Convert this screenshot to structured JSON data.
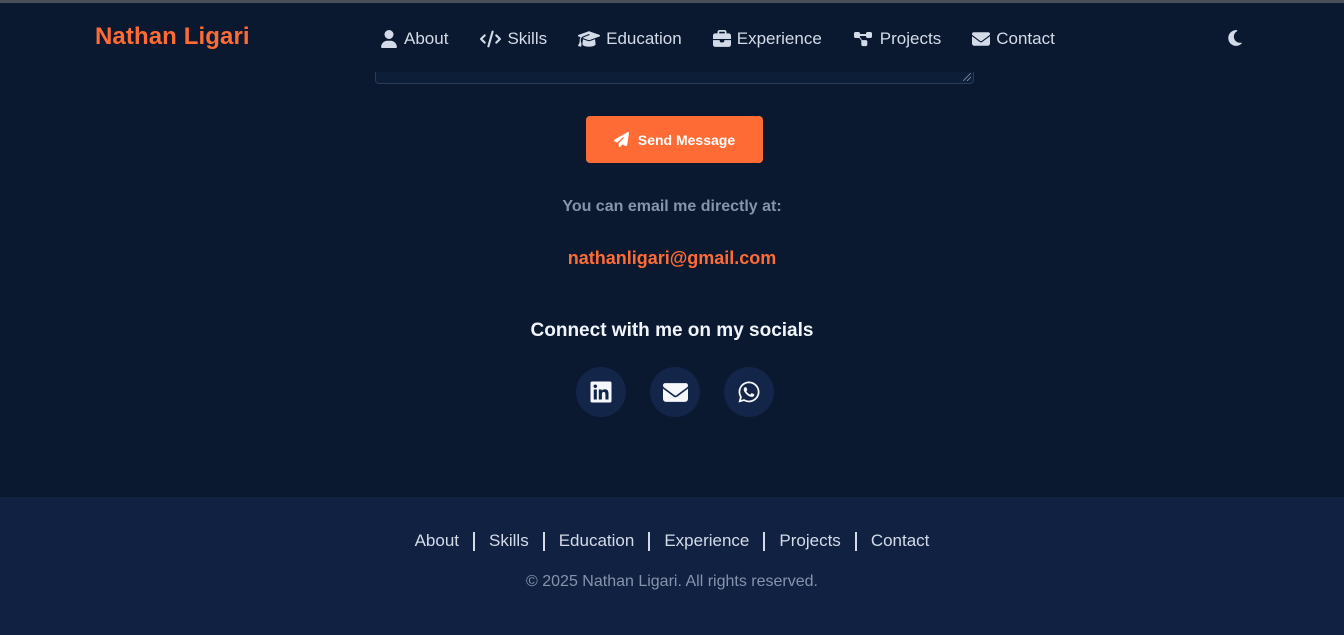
{
  "brand": "Nathan Ligari",
  "nav": {
    "items": [
      {
        "label": "About",
        "icon": "user-icon"
      },
      {
        "label": "Skills",
        "icon": "code-icon"
      },
      {
        "label": "Education",
        "icon": "graduation-cap-icon"
      },
      {
        "label": "Experience",
        "icon": "briefcase-icon"
      },
      {
        "label": "Projects",
        "icon": "project-diagram-icon"
      },
      {
        "label": "Contact",
        "icon": "envelope-icon"
      }
    ],
    "theme_toggle_icon": "moon-icon"
  },
  "contact": {
    "send_button_label": "Send Message",
    "send_button_icon": "paper-plane-icon",
    "direct_label": "You can email me directly at:",
    "email": "nathanligari@gmail.com",
    "socials_heading": "Connect with me on my socials",
    "socials": [
      {
        "icon": "linkedin-icon"
      },
      {
        "icon": "envelope-icon"
      },
      {
        "icon": "whatsapp-icon"
      }
    ]
  },
  "footer": {
    "links": [
      "About",
      "Skills",
      "Education",
      "Experience",
      "Projects",
      "Contact"
    ],
    "copyright": "© 2025 Nathan Ligari. All rights reserved."
  },
  "colors": {
    "background": "#0a1930",
    "footer_background": "#112142",
    "accent": "#ff6b35",
    "social_circle": "#13264a"
  }
}
